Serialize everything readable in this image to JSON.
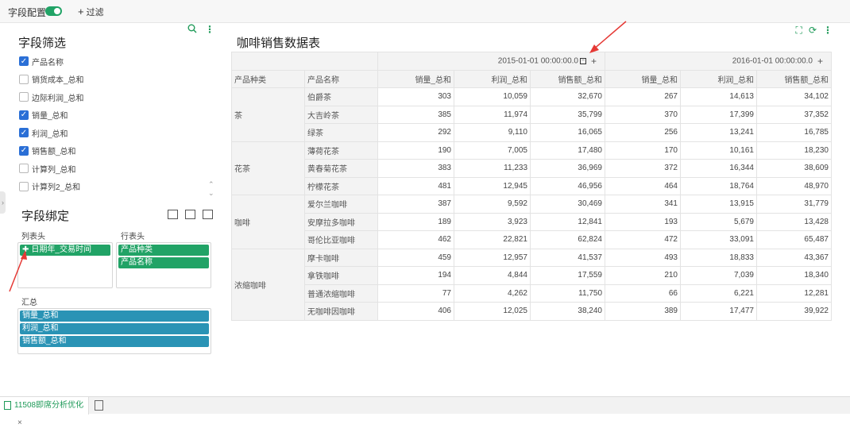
{
  "topbar": {
    "field_config_label": "字段配置",
    "filter_label": "过滤"
  },
  "left": {
    "filter_title": "字段筛选",
    "fields": [
      {
        "label": "产品名称",
        "checked": true
      },
      {
        "label": "销货成本_总和",
        "checked": false
      },
      {
        "label": "边际利润_总和",
        "checked": false
      },
      {
        "label": "销量_总和",
        "checked": true
      },
      {
        "label": "利润_总和",
        "checked": true
      },
      {
        "label": "销售额_总和",
        "checked": true
      },
      {
        "label": "计算列_总和",
        "checked": false
      },
      {
        "label": "计算列2_总和",
        "checked": false
      }
    ],
    "binding_title": "字段绑定",
    "col_header_label": "列表头",
    "row_header_label": "行表头",
    "summary_label": "汇总",
    "col_fields": [
      "日期年_交易时间"
    ],
    "row_fields": [
      "产品种类",
      "产品名称"
    ],
    "summary_fields": [
      "销量_总和",
      "利润_总和",
      "销售额_总和"
    ]
  },
  "table": {
    "title": "咖啡销售数据表",
    "date_headers": [
      "2015-01-01 00:00:00.0",
      "2016-01-01 00:00:00.0"
    ],
    "col_headers": [
      "产品种类",
      "产品名称",
      "销量_总和",
      "利润_总和",
      "销售额_总和",
      "销量_总和",
      "利润_总和",
      "销售额_总和"
    ],
    "groups": [
      {
        "category": "茶",
        "rows": [
          {
            "name": "伯爵茶",
            "v": [
              "303",
              "10,059",
              "32,670",
              "267",
              "14,613",
              "34,102"
            ]
          },
          {
            "name": "大吉岭茶",
            "v": [
              "385",
              "11,974",
              "35,799",
              "370",
              "17,399",
              "37,352"
            ]
          },
          {
            "name": "绿茶",
            "v": [
              "292",
              "9,110",
              "16,065",
              "256",
              "13,241",
              "16,785"
            ]
          }
        ]
      },
      {
        "category": "花茶",
        "rows": [
          {
            "name": "薄荷花茶",
            "v": [
              "190",
              "7,005",
              "17,480",
              "170",
              "10,161",
              "18,230"
            ]
          },
          {
            "name": "黄春菊花茶",
            "v": [
              "383",
              "11,233",
              "36,969",
              "372",
              "16,344",
              "38,609"
            ]
          },
          {
            "name": "柠檬花茶",
            "v": [
              "481",
              "12,945",
              "46,956",
              "464",
              "18,764",
              "48,970"
            ]
          }
        ]
      },
      {
        "category": "咖啡",
        "rows": [
          {
            "name": "爱尔兰咖啡",
            "v": [
              "387",
              "9,592",
              "30,469",
              "341",
              "13,915",
              "31,779"
            ]
          },
          {
            "name": "安摩拉多咖啡",
            "v": [
              "189",
              "3,923",
              "12,841",
              "193",
              "5,679",
              "13,428"
            ]
          },
          {
            "name": "哥伦比亚咖啡",
            "v": [
              "462",
              "22,821",
              "62,824",
              "472",
              "33,091",
              "65,487"
            ]
          }
        ]
      },
      {
        "category": "浓缩咖啡",
        "rows": [
          {
            "name": "摩卡咖啡",
            "v": [
              "459",
              "12,957",
              "41,537",
              "493",
              "18,833",
              "43,367"
            ]
          },
          {
            "name": "拿铁咖啡",
            "v": [
              "194",
              "4,844",
              "17,559",
              "210",
              "7,039",
              "18,340"
            ]
          },
          {
            "name": "普通浓缩咖啡",
            "v": [
              "77",
              "4,262",
              "11,750",
              "66",
              "6,221",
              "12,281"
            ]
          },
          {
            "name": "无咖啡因咖啡",
            "v": [
              "406",
              "12,025",
              "38,240",
              "389",
              "17,477",
              "39,922"
            ]
          }
        ]
      }
    ]
  },
  "statusbar": {
    "tab_label": "11508即席分析优化"
  },
  "colors": {
    "accent": "#21a366",
    "teal_chip": "#2a93b5",
    "arrow": "#e53935",
    "checkbox": "#2a6fd6"
  }
}
